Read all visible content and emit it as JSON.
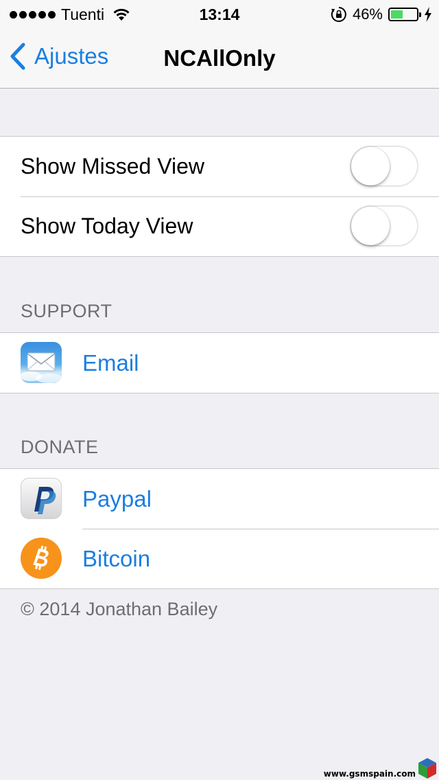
{
  "status_bar": {
    "carrier": "Tuenti",
    "time": "13:14",
    "battery_percent": "46%",
    "battery_level": 0.46,
    "signal_bars": 5,
    "icons": [
      "signal-dots-icon",
      "wifi-icon",
      "orientation-lock-icon",
      "battery-icon",
      "charging-bolt-icon"
    ]
  },
  "nav": {
    "back_label": "Ajustes",
    "title": "NCAllOnly",
    "accent_color": "#1b7ee0"
  },
  "toggles": [
    {
      "label": "Show Missed View",
      "on": false
    },
    {
      "label": "Show Today View",
      "on": false
    }
  ],
  "support": {
    "header": "SUPPORT",
    "items": [
      {
        "label": "Email",
        "icon": "mail-app-icon"
      }
    ]
  },
  "donate": {
    "header": "DONATE",
    "items": [
      {
        "label": "Paypal",
        "icon": "paypal-icon"
      },
      {
        "label": "Bitcoin",
        "icon": "bitcoin-icon"
      }
    ]
  },
  "footer": "© 2014 Jonathan Bailey",
  "watermark": "www.gsmspain.com"
}
